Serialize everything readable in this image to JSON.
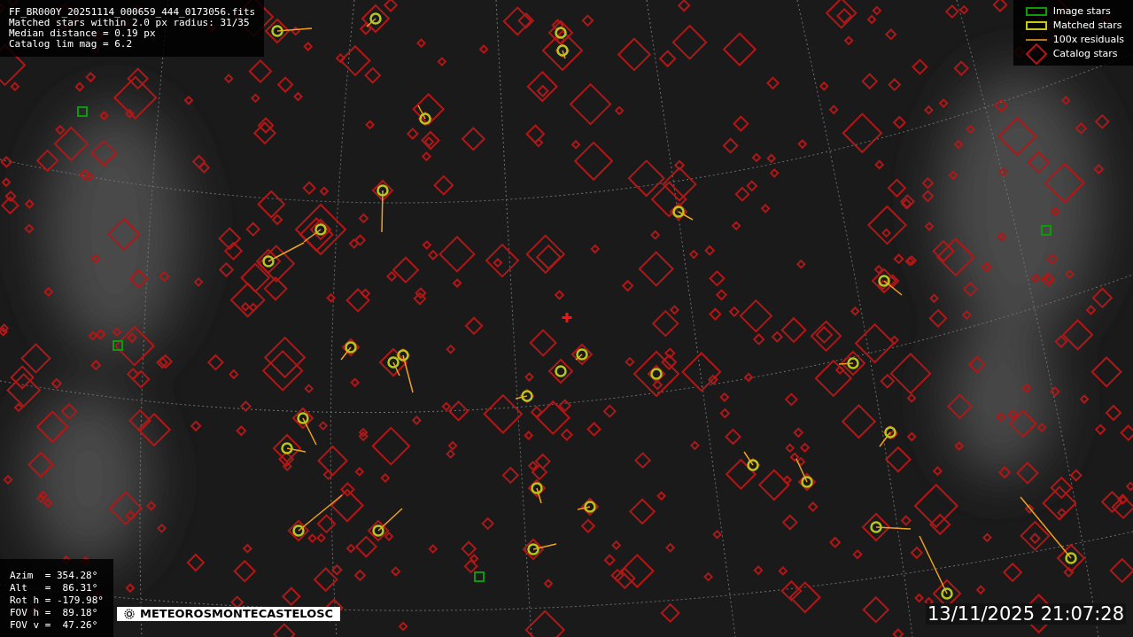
{
  "info": [
    "FF_BR000Y_20251114_000659_444_0173056.fits",
    "Matched stars within 2.0 px radius: 31/35",
    "Median distance = 0.19 px",
    "Catalog lim mag = 6.2"
  ],
  "legend": [
    {
      "kind": "image",
      "label": "Image stars"
    },
    {
      "kind": "matched",
      "label": "Matched stars"
    },
    {
      "kind": "residual",
      "label": "100x residuals"
    },
    {
      "kind": "catalog",
      "label": "Catalog stars"
    }
  ],
  "pointing": [
    "Azim  = 354.28°",
    "Alt   =  86.31°",
    "Rot h = -179.98°",
    "FOV h =  89.18°",
    "FOV v =  47.26°"
  ],
  "banner": {
    "text": "METEOROSMONTECASTELOSC"
  },
  "timestamp": "13/11/2025 21:07:28"
}
